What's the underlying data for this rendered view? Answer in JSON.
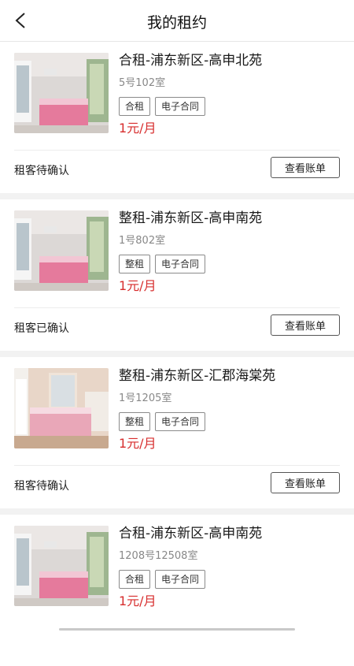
{
  "header": {
    "title": "我的租约"
  },
  "listings": [
    {
      "title": "合租-浦东新区-高申北苑",
      "room": "5号102室",
      "tags": [
        "合租",
        "电子合同"
      ],
      "price": "1元/月",
      "status": "租客待确认",
      "action": "查看账单"
    },
    {
      "title": "整租-浦东新区-高申南苑",
      "room": "1号802室",
      "tags": [
        "整租",
        "电子合同"
      ],
      "price": "1元/月",
      "status": "租客已确认",
      "action": "查看账单"
    },
    {
      "title": "整租-浦东新区-汇郡海棠苑",
      "room": "1号1205室",
      "tags": [
        "整租",
        "电子合同"
      ],
      "price": "1元/月",
      "status": "租客待确认",
      "action": "查看账单"
    },
    {
      "title": "合租-浦东新区-高申南苑",
      "room": "1208号12508室",
      "tags": [
        "合租",
        "电子合同"
      ],
      "price": "1元/月",
      "status": "",
      "action": ""
    }
  ],
  "icons": {
    "back": "chevron-left-icon",
    "photo": "bedroom-photo"
  },
  "colors": {
    "price": "#d72d2d",
    "background": "#f2f2f2"
  }
}
